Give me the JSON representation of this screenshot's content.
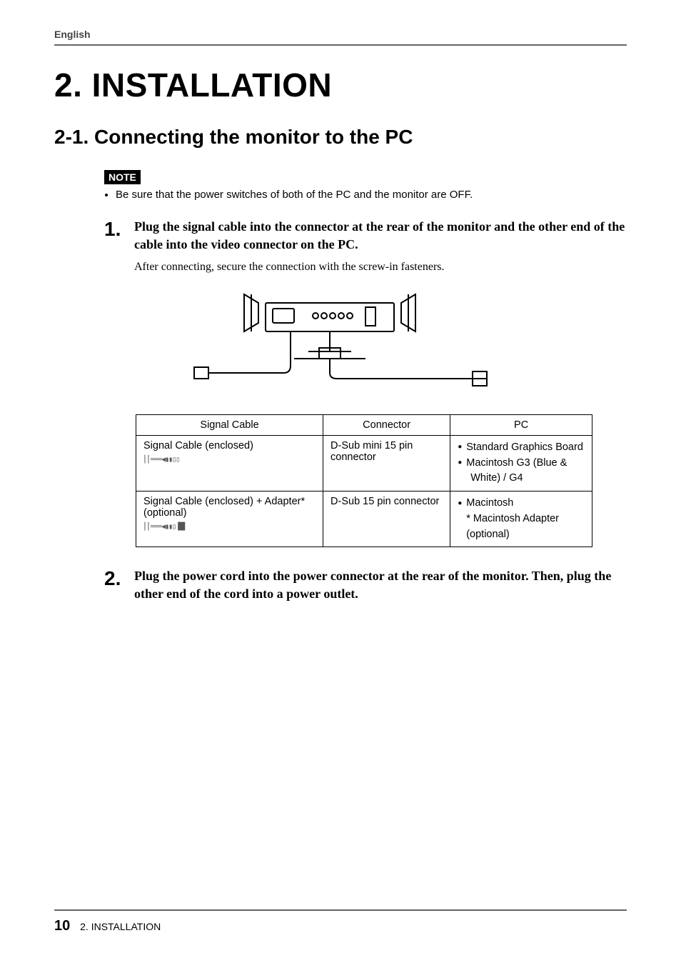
{
  "header": {
    "language": "English"
  },
  "chapter": {
    "title": "2. INSTALLATION"
  },
  "section": {
    "title": "2-1. Connecting the monitor to the PC"
  },
  "note": {
    "label": "NOTE",
    "items": [
      "Be sure that the power switches of both of the PC and the monitor are OFF."
    ]
  },
  "steps": [
    {
      "num": "1.",
      "head": "Plug the signal cable into the connector at the rear of the monitor and the other end of the cable into the video connector on the PC.",
      "sub": "After connecting, secure the connection with the screw-in fasteners."
    },
    {
      "num": "2.",
      "head": "Plug the power cord into the power connector at the rear of the monitor.  Then, plug the other end of the cord into a power outlet.",
      "sub": ""
    }
  ],
  "table": {
    "headers": [
      "Signal Cable",
      "Connector",
      "PC"
    ],
    "rows": [
      {
        "cable": "Signal Cable (enclosed)",
        "connector": "D-Sub mini 15 pin connector",
        "pc_lines": [
          {
            "type": "dot",
            "text": "Standard Graphics Board"
          },
          {
            "type": "dot",
            "text": "Macintosh G3 (Blue &"
          },
          {
            "type": "sub",
            "text": "White) / G4"
          }
        ]
      },
      {
        "cable": "Signal Cable (enclosed) + Adapter* (optional)",
        "connector": "D-Sub 15 pin connector",
        "pc_lines": [
          {
            "type": "dot",
            "text": "Macintosh"
          },
          {
            "type": "star",
            "text": "* Macintosh Adapter (optional)"
          }
        ]
      }
    ]
  },
  "footer": {
    "pageNumber": "10",
    "chapterRef": "2. INSTALLATION"
  }
}
